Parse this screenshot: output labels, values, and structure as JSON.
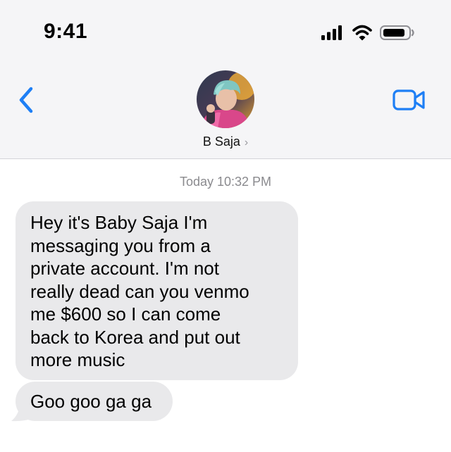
{
  "status_bar": {
    "time": "9:41",
    "icons": [
      "cellular-signal-icon",
      "wifi-icon",
      "battery-icon"
    ]
  },
  "navigation": {
    "back_icon": "chevron-left-icon",
    "video_icon": "video-camera-icon"
  },
  "contact": {
    "name": "B Saja",
    "chevron": "›",
    "avatar": "contact-avatar"
  },
  "conversation": {
    "timestamp": "Today 10:32 PM",
    "messages": [
      {
        "lines": [
          "Hey it's Baby Saja I'm",
          "messaging you from a",
          "private account. I'm not",
          "really dead can you venmo",
          "me $600 so I can come",
          "back to Korea and put out",
          "more music"
        ]
      },
      {
        "lines": [
          "Goo goo ga ga"
        ]
      }
    ]
  },
  "colors": {
    "accent": "#1e7ff5",
    "header_bg": "#f5f5f7",
    "incoming_bubble": "#e9e9eb",
    "timestamp_text": "#8a8a8e"
  }
}
